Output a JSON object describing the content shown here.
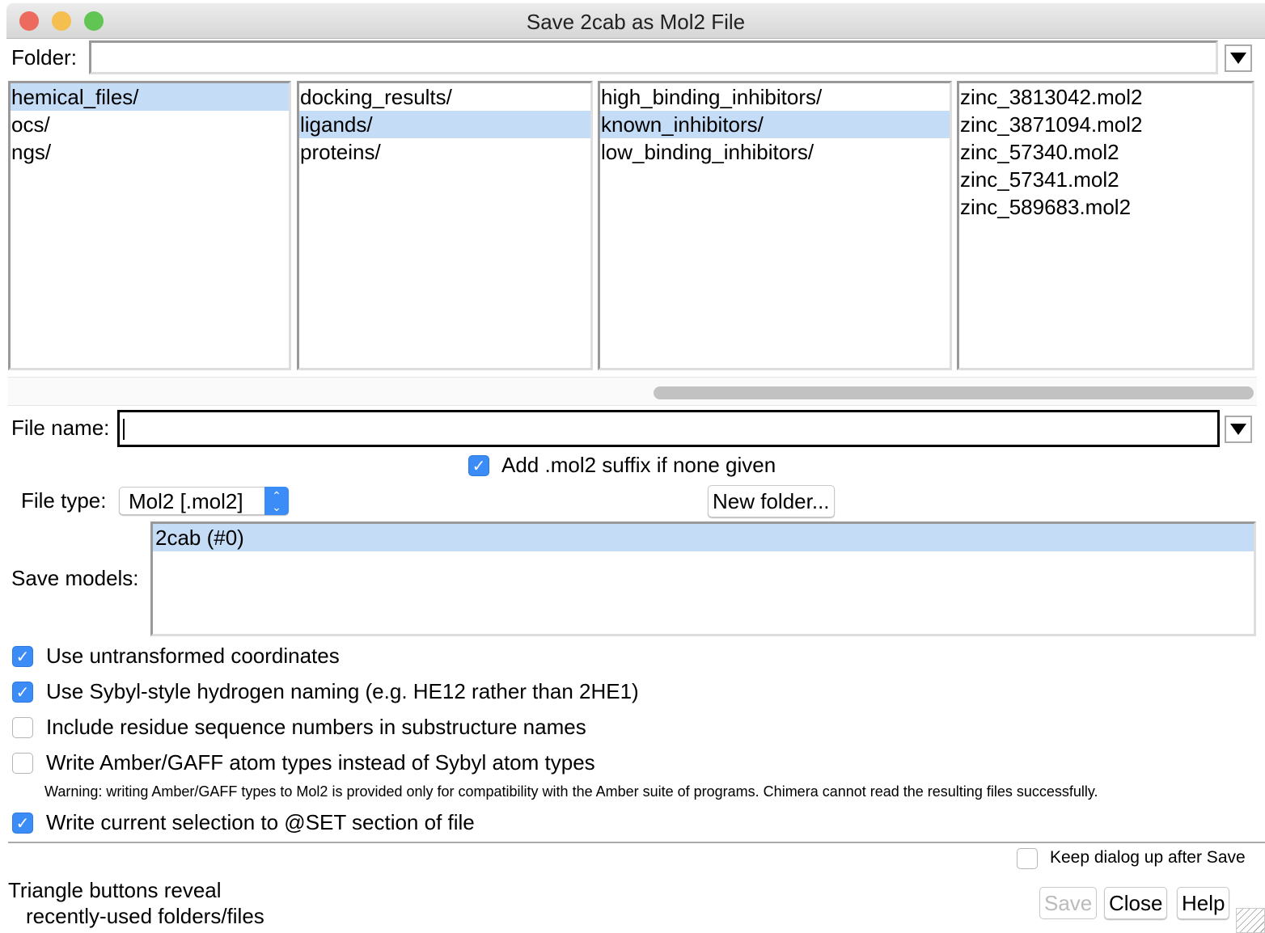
{
  "window": {
    "title": "Save 2cab as Mol2 File"
  },
  "folder": {
    "label": "Folder:",
    "value": ""
  },
  "browser": {
    "columns": [
      {
        "items": [
          "hemical_files/",
          "ocs/",
          "ngs/"
        ],
        "selected": 0
      },
      {
        "items": [
          "docking_results/",
          "ligands/",
          "proteins/"
        ],
        "selected": 1
      },
      {
        "items": [
          "high_binding_inhibitors/",
          "known_inhibitors/",
          "low_binding_inhibitors/"
        ],
        "selected": 1
      },
      {
        "items": [
          "zinc_3813042.mol2",
          "zinc_3871094.mol2",
          "zinc_57340.mol2",
          "zinc_57341.mol2",
          "zinc_589683.mol2"
        ],
        "selected": -1
      }
    ]
  },
  "file_name": {
    "label": "File name:",
    "value": ""
  },
  "add_suffix": {
    "label": "Add .mol2 suffix if none given",
    "checked": true
  },
  "file_type": {
    "label": "File type:",
    "value": "Mol2 [.mol2]"
  },
  "new_folder": "New folder...",
  "save_models": {
    "label": "Save models:",
    "items": [
      "2cab (#0)"
    ]
  },
  "options": [
    {
      "label": "Use untransformed coordinates",
      "checked": true
    },
    {
      "label": "Use Sybyl-style hydrogen naming (e.g. HE12 rather than 2HE1)",
      "checked": true
    },
    {
      "label": "Include residue sequence numbers in substructure names",
      "checked": false
    },
    {
      "label": "Write Amber/GAFF atom types instead of Sybyl atom types",
      "checked": false
    }
  ],
  "warning": "Warning: writing Amber/GAFF types to Mol2 is provided only for compatibility with the Amber suite of programs. Chimera cannot read the resulting files successfully.",
  "write_selection": {
    "label": "Write current selection to @SET section of file",
    "checked": true
  },
  "keep_dialog": {
    "label": "Keep dialog up after Save",
    "checked": false
  },
  "hint": {
    "line1": "Triangle buttons reveal",
    "line2": "recently-used folders/files"
  },
  "buttons": {
    "save": "Save",
    "close": "Close",
    "help": "Help"
  },
  "colors": {
    "selection": "#c5dcf7",
    "accent": "#3b8cf6"
  }
}
